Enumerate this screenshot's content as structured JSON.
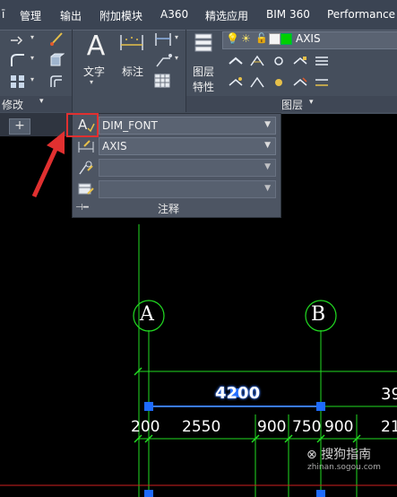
{
  "menu": {
    "partial_left": "ī",
    "items": [
      "管理",
      "输出",
      "附加模块",
      "A360",
      "精选应用",
      "BIM 360",
      "Performance"
    ]
  },
  "ribbon": {
    "modify_footer": "修改",
    "text_label": "文字",
    "dim_label": "标注",
    "layer_props_line1": "图层",
    "layer_props_line2": "特性",
    "layer_name": "AXIS",
    "layer_color": "#00d000",
    "layer_footer": "图层"
  },
  "tabs": {
    "add": "+"
  },
  "annotation_panel": {
    "text_style": "DIM_FONT",
    "dim_style": "AXIS",
    "leader_style": "",
    "table_style": "",
    "footer": "注释"
  },
  "drawing": {
    "grid_bubble_a": "A",
    "grid_bubble_b": "B",
    "dim_top_value": "4200",
    "dim_top_right": "39",
    "dims_bottom": [
      "200",
      "2550",
      "900",
      "750",
      "900",
      "21"
    ]
  },
  "watermark": {
    "main": "搜狗指南",
    "sub": "zhinan.sogou.com"
  },
  "colors": {
    "grid_line": "#22dd22",
    "grip": "#1e6bff",
    "arrow": "#e13030"
  }
}
